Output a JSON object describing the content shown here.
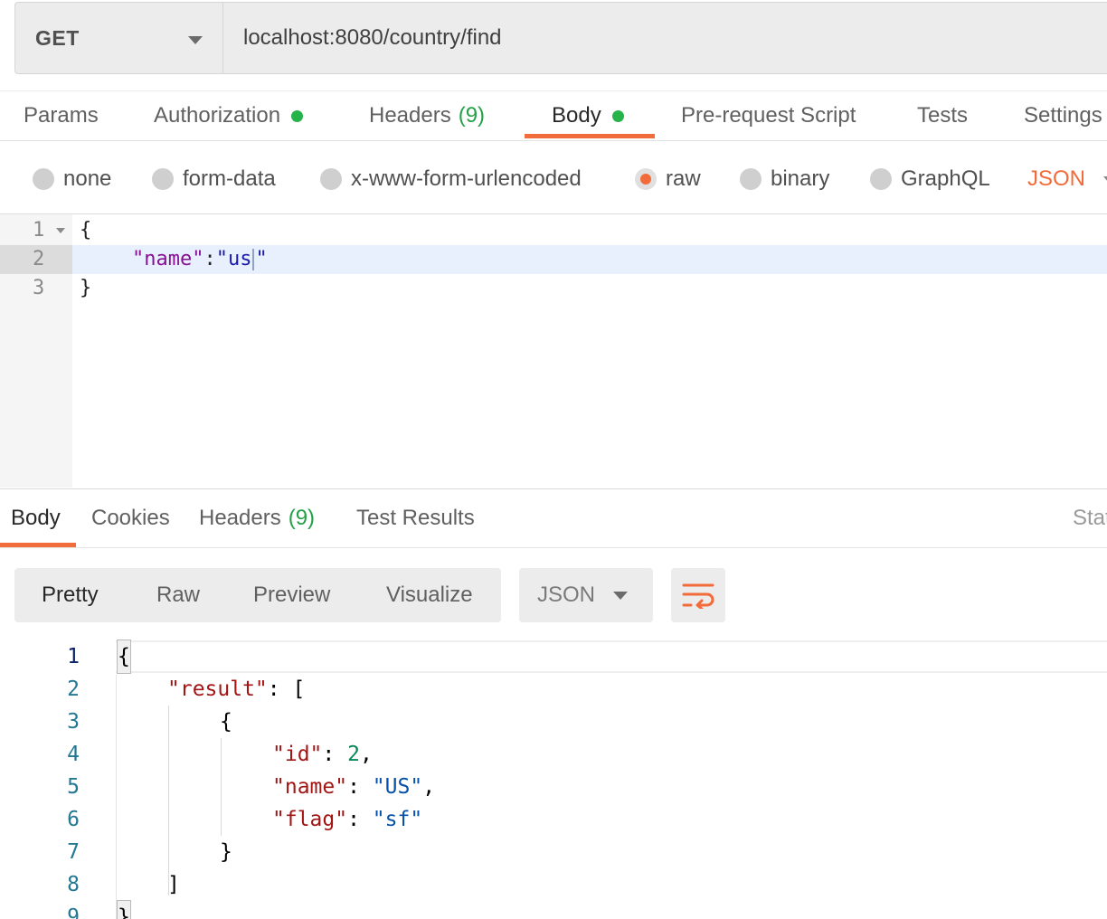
{
  "request": {
    "method": "GET",
    "url": "localhost:8080/country/find"
  },
  "request_tabs": [
    {
      "label": "Params"
    },
    {
      "label": "Authorization"
    },
    {
      "label": "Headers",
      "count": "(9)"
    },
    {
      "label": "Body"
    },
    {
      "label": "Pre-request Script"
    },
    {
      "label": "Tests"
    },
    {
      "label": "Settings"
    }
  ],
  "body_types": {
    "options": [
      "none",
      "form-data",
      "x-www-form-urlencoded",
      "raw",
      "binary",
      "GraphQL"
    ],
    "selected": "raw",
    "format": "JSON"
  },
  "request_editor": {
    "line_numbers": [
      "1",
      "2",
      "3"
    ],
    "open_brace": "{",
    "key": "\"name\"",
    "colon": ":",
    "value_text": "\"us",
    "value_end": "\"",
    "close_brace": "}"
  },
  "response_tabs": [
    {
      "label": "Body"
    },
    {
      "label": "Cookies"
    },
    {
      "label": "Headers",
      "count": "(9)"
    },
    {
      "label": "Test Results"
    }
  ],
  "status_label": "Stat",
  "view_modes": [
    "Pretty",
    "Raw",
    "Preview",
    "Visualize"
  ],
  "response_format": "JSON",
  "response_body": {
    "line_numbers": [
      "1",
      "2",
      "3",
      "4",
      "5",
      "6",
      "7",
      "8",
      "9"
    ],
    "open_brace": "{",
    "result_key": "\"result\"",
    "colon_bracket": ": [",
    "inner_open": "{",
    "id_key": "\"id\"",
    "id_value": "2",
    "name_key": "\"name\"",
    "name_value": "\"US\"",
    "flag_key": "\"flag\"",
    "flag_value": "\"sf\"",
    "colon": ": ",
    "comma": ",",
    "inner_close": "}",
    "bracket_close": "]",
    "close_brace": "}"
  },
  "colors": {
    "accent": "#f26b3a",
    "active_dot": "#26b34a"
  }
}
